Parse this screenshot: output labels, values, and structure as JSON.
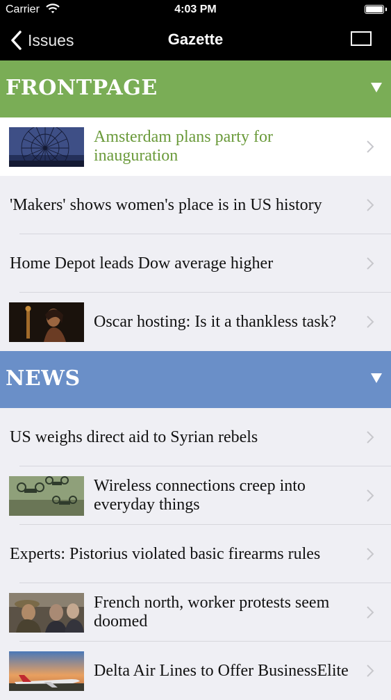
{
  "status_bar": {
    "carrier": "Carrier",
    "time": "4:03 PM"
  },
  "nav": {
    "back_label": "Issues",
    "title": "Gazette"
  },
  "sections": [
    {
      "title": "FRONTPAGE",
      "color": "#7aad56",
      "articles": [
        {
          "title": "Amsterdam plans party for inauguration",
          "thumbnail": "ferris-wheel-photo",
          "selected": true
        },
        {
          "title": "'Makers' shows women's place is in US history"
        },
        {
          "title": "Home Depot leads Dow average higher"
        },
        {
          "title": "Oscar hosting: Is it a thankless task?",
          "thumbnail": "oscar-statue-photo"
        }
      ]
    },
    {
      "title": "NEWS",
      "color": "#6a8fc8",
      "articles": [
        {
          "title": "US weighs direct aid to Syrian rebels"
        },
        {
          "title": "Wireless connections creep into everyday things",
          "thumbnail": "drones-photo"
        },
        {
          "title": "Experts: Pistorius violated basic firearms rules"
        },
        {
          "title": "French north, worker protests seem doomed",
          "thumbnail": "protesters-photo"
        },
        {
          "title": "Delta Air Lines to Offer BusinessElite",
          "thumbnail": "airplane-photo"
        }
      ]
    }
  ],
  "colors": {
    "selected_title": "#6a9a3a",
    "chevron": "#c7c7cc",
    "list_background": "#efeff4"
  }
}
